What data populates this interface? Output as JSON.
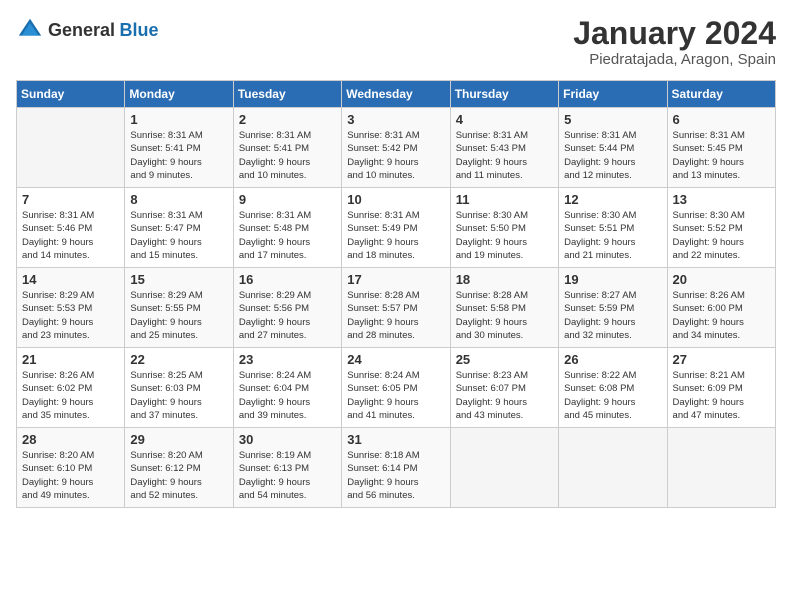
{
  "header": {
    "logo_general": "General",
    "logo_blue": "Blue",
    "month": "January 2024",
    "location": "Piedratajada, Aragon, Spain"
  },
  "weekdays": [
    "Sunday",
    "Monday",
    "Tuesday",
    "Wednesday",
    "Thursday",
    "Friday",
    "Saturday"
  ],
  "weeks": [
    [
      {
        "day": "",
        "info": ""
      },
      {
        "day": "1",
        "info": "Sunrise: 8:31 AM\nSunset: 5:41 PM\nDaylight: 9 hours\nand 9 minutes."
      },
      {
        "day": "2",
        "info": "Sunrise: 8:31 AM\nSunset: 5:41 PM\nDaylight: 9 hours\nand 10 minutes."
      },
      {
        "day": "3",
        "info": "Sunrise: 8:31 AM\nSunset: 5:42 PM\nDaylight: 9 hours\nand 10 minutes."
      },
      {
        "day": "4",
        "info": "Sunrise: 8:31 AM\nSunset: 5:43 PM\nDaylight: 9 hours\nand 11 minutes."
      },
      {
        "day": "5",
        "info": "Sunrise: 8:31 AM\nSunset: 5:44 PM\nDaylight: 9 hours\nand 12 minutes."
      },
      {
        "day": "6",
        "info": "Sunrise: 8:31 AM\nSunset: 5:45 PM\nDaylight: 9 hours\nand 13 minutes."
      }
    ],
    [
      {
        "day": "7",
        "info": "Sunrise: 8:31 AM\nSunset: 5:46 PM\nDaylight: 9 hours\nand 14 minutes."
      },
      {
        "day": "8",
        "info": "Sunrise: 8:31 AM\nSunset: 5:47 PM\nDaylight: 9 hours\nand 15 minutes."
      },
      {
        "day": "9",
        "info": "Sunrise: 8:31 AM\nSunset: 5:48 PM\nDaylight: 9 hours\nand 17 minutes."
      },
      {
        "day": "10",
        "info": "Sunrise: 8:31 AM\nSunset: 5:49 PM\nDaylight: 9 hours\nand 18 minutes."
      },
      {
        "day": "11",
        "info": "Sunrise: 8:30 AM\nSunset: 5:50 PM\nDaylight: 9 hours\nand 19 minutes."
      },
      {
        "day": "12",
        "info": "Sunrise: 8:30 AM\nSunset: 5:51 PM\nDaylight: 9 hours\nand 21 minutes."
      },
      {
        "day": "13",
        "info": "Sunrise: 8:30 AM\nSunset: 5:52 PM\nDaylight: 9 hours\nand 22 minutes."
      }
    ],
    [
      {
        "day": "14",
        "info": "Sunrise: 8:29 AM\nSunset: 5:53 PM\nDaylight: 9 hours\nand 23 minutes."
      },
      {
        "day": "15",
        "info": "Sunrise: 8:29 AM\nSunset: 5:55 PM\nDaylight: 9 hours\nand 25 minutes."
      },
      {
        "day": "16",
        "info": "Sunrise: 8:29 AM\nSunset: 5:56 PM\nDaylight: 9 hours\nand 27 minutes."
      },
      {
        "day": "17",
        "info": "Sunrise: 8:28 AM\nSunset: 5:57 PM\nDaylight: 9 hours\nand 28 minutes."
      },
      {
        "day": "18",
        "info": "Sunrise: 8:28 AM\nSunset: 5:58 PM\nDaylight: 9 hours\nand 30 minutes."
      },
      {
        "day": "19",
        "info": "Sunrise: 8:27 AM\nSunset: 5:59 PM\nDaylight: 9 hours\nand 32 minutes."
      },
      {
        "day": "20",
        "info": "Sunrise: 8:26 AM\nSunset: 6:00 PM\nDaylight: 9 hours\nand 34 minutes."
      }
    ],
    [
      {
        "day": "21",
        "info": "Sunrise: 8:26 AM\nSunset: 6:02 PM\nDaylight: 9 hours\nand 35 minutes."
      },
      {
        "day": "22",
        "info": "Sunrise: 8:25 AM\nSunset: 6:03 PM\nDaylight: 9 hours\nand 37 minutes."
      },
      {
        "day": "23",
        "info": "Sunrise: 8:24 AM\nSunset: 6:04 PM\nDaylight: 9 hours\nand 39 minutes."
      },
      {
        "day": "24",
        "info": "Sunrise: 8:24 AM\nSunset: 6:05 PM\nDaylight: 9 hours\nand 41 minutes."
      },
      {
        "day": "25",
        "info": "Sunrise: 8:23 AM\nSunset: 6:07 PM\nDaylight: 9 hours\nand 43 minutes."
      },
      {
        "day": "26",
        "info": "Sunrise: 8:22 AM\nSunset: 6:08 PM\nDaylight: 9 hours\nand 45 minutes."
      },
      {
        "day": "27",
        "info": "Sunrise: 8:21 AM\nSunset: 6:09 PM\nDaylight: 9 hours\nand 47 minutes."
      }
    ],
    [
      {
        "day": "28",
        "info": "Sunrise: 8:20 AM\nSunset: 6:10 PM\nDaylight: 9 hours\nand 49 minutes."
      },
      {
        "day": "29",
        "info": "Sunrise: 8:20 AM\nSunset: 6:12 PM\nDaylight: 9 hours\nand 52 minutes."
      },
      {
        "day": "30",
        "info": "Sunrise: 8:19 AM\nSunset: 6:13 PM\nDaylight: 9 hours\nand 54 minutes."
      },
      {
        "day": "31",
        "info": "Sunrise: 8:18 AM\nSunset: 6:14 PM\nDaylight: 9 hours\nand 56 minutes."
      },
      {
        "day": "",
        "info": ""
      },
      {
        "day": "",
        "info": ""
      },
      {
        "day": "",
        "info": ""
      }
    ]
  ]
}
